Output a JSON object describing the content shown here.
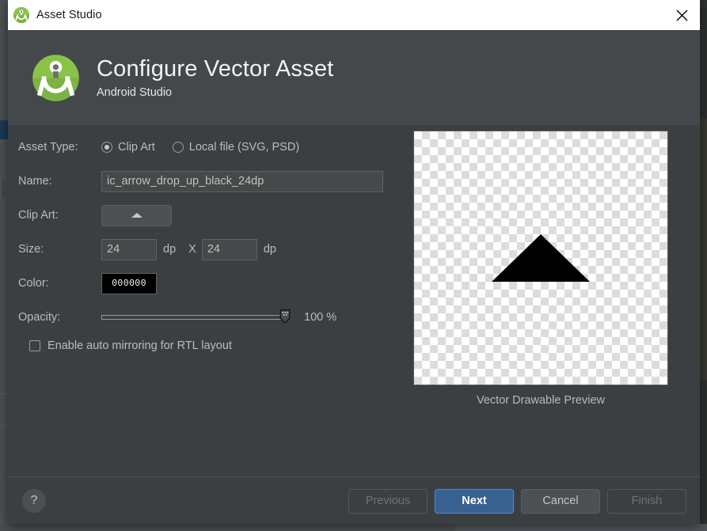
{
  "window": {
    "title": "Asset Studio",
    "title_icon": "android-studio-icon",
    "close_icon": "close-icon"
  },
  "header": {
    "logo_icon": "android-studio-compass-logo",
    "title": "Configure Vector Asset",
    "subtitle": "Android Studio"
  },
  "form": {
    "asset_type": {
      "label": "Asset Type:",
      "selected": "Clip Art",
      "options": [
        {
          "label": "Clip Art",
          "selected": true
        },
        {
          "label": "Local file (SVG, PSD)",
          "selected": false
        }
      ]
    },
    "name": {
      "label": "Name:",
      "value": "ic_arrow_drop_up_black_24dp",
      "placeholder": ""
    },
    "clip_art": {
      "label": "Clip Art:",
      "button_icon": "triangle-up-icon"
    },
    "size": {
      "label": "Size:",
      "width": "24",
      "height": "24",
      "unit": "dp",
      "separator": "X"
    },
    "color": {
      "label": "Color:",
      "hex": "000000",
      "swatch_color": "#000000"
    },
    "opacity": {
      "label": "Opacity:",
      "value": 100,
      "min": 0,
      "max": 100,
      "display": "100 %"
    },
    "rtl": {
      "label": "Enable auto mirroring for RTL layout",
      "checked": false
    }
  },
  "preview": {
    "caption": "Vector Drawable Preview",
    "shape_icon": "triangle-up-icon",
    "shape_color": "#000000",
    "background": "transparency-checkerboard"
  },
  "footer": {
    "help_icon": "question-mark-icon",
    "buttons": [
      {
        "label": "Previous",
        "state": "disabled"
      },
      {
        "label": "Next",
        "state": "primary"
      },
      {
        "label": "Cancel",
        "state": "normal"
      },
      {
        "label": "Finish",
        "state": "disabled"
      }
    ]
  }
}
